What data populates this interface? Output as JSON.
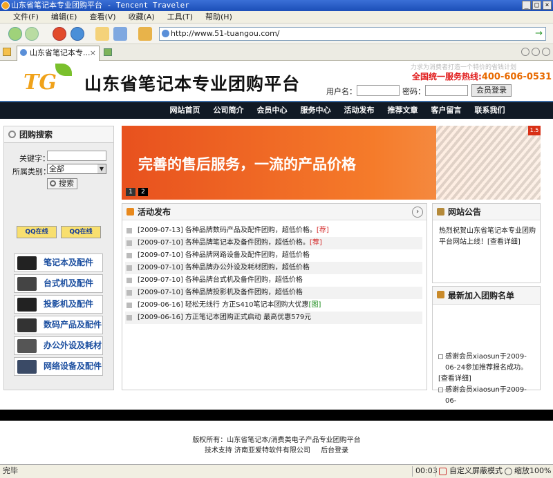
{
  "window": {
    "title": "山东省笔记本专业团购平台 - Tencent Traveler",
    "minimize": "_",
    "maximize": "□",
    "close": "×"
  },
  "menu": [
    "文件(F)",
    "编辑(E)",
    "查看(V)",
    "收藏(A)",
    "工具(T)",
    "帮助(H)"
  ],
  "address": {
    "url": "http://www.51-tuangou.com/",
    "go": "→"
  },
  "tab": {
    "label": "山东省笔记本专...",
    "close": "×"
  },
  "header": {
    "logo": "TG",
    "title": "山东省笔记本专业团购平台",
    "slogan": "力求为消费者打造一个特价的省钱计划",
    "hotline_prefix": "全国统一服务热线:",
    "hotline_number": "400-606-0531",
    "username_label": "用户名：",
    "password_label": "密码：",
    "login_button": "会员登录"
  },
  "nav": [
    "网站首页",
    "公司简介",
    "会员中心",
    "服务中心",
    "活动发布",
    "推荐文章",
    "客户留言",
    "联系我们"
  ],
  "search": {
    "title": "团购搜索",
    "keyword_label": "关键字：",
    "category_label": "所属类别：",
    "category_value": "全部",
    "search_button": "搜索"
  },
  "qq": [
    "QQ在线",
    "QQ在线"
  ],
  "categories": [
    "笔记本及配件",
    "台式机及配件",
    "投影机及配件",
    "数码产品及配件",
    "办公外设及耗材",
    "网络设备及配件"
  ],
  "banner": {
    "text": "完善的售后服务，一流的产品价格",
    "pages": [
      "1",
      "2"
    ],
    "badge": "1.5"
  },
  "activities": {
    "title": "活动发布",
    "more": "›",
    "items": [
      {
        "date": "[2009-07-13]",
        "text": "各种品牌数码产品及配件团购，超低价格。",
        "tag": "[荐]",
        "tag_color": "#d22222"
      },
      {
        "date": "[2009-07-10]",
        "text": "各种品牌笔记本及备件团购，超低价格。",
        "tag": "[荐]",
        "tag_color": "#d22222"
      },
      {
        "date": "[2009-07-10]",
        "text": "各种品牌网路设备及配件团购，超低价格",
        "tag": "",
        "tag_color": ""
      },
      {
        "date": "[2009-07-10]",
        "text": "各种品牌办公外设及耗材团购，超低价格",
        "tag": "",
        "tag_color": ""
      },
      {
        "date": "[2009-07-10]",
        "text": "各种品牌台式机及备件团购，超低价格",
        "tag": "",
        "tag_color": ""
      },
      {
        "date": "[2009-07-10]",
        "text": "各种品牌投影机及备件团购，超低价格",
        "tag": "",
        "tag_color": ""
      },
      {
        "date": "[2009-06-16]",
        "text": "轻松无线行 方正S410笔记本团购大优惠",
        "tag": "[图]",
        "tag_color": "#1a8a1a"
      },
      {
        "date": "[2009-06-16]",
        "text": "方正笔记本团购正式启动 最高优惠579元",
        "tag": "",
        "tag_color": ""
      }
    ]
  },
  "notice": {
    "title": "网站公告",
    "text": "热烈祝贺山东省笔记本专业团购平台网站上线！[查看详细]"
  },
  "newest": {
    "title": "最新加入团购名单",
    "entry1": "感谢会员xiaosun于2009-06-24参加推荐报名成功。",
    "detail": "[查看详细]",
    "entry2": "感谢会员xiaosun于2009-06-"
  },
  "footer": {
    "copyright": "版权所有：山东省笔记本/消费类电子产品专业团购平台",
    "support": "技术支持 济南亚爱特软件有限公司",
    "admin": "后台登录"
  },
  "status": {
    "left": "完毕",
    "time": "00:03",
    "mode": "自定义屏蔽模式",
    "zoom_label": "缩放",
    "zoom": "100%"
  }
}
